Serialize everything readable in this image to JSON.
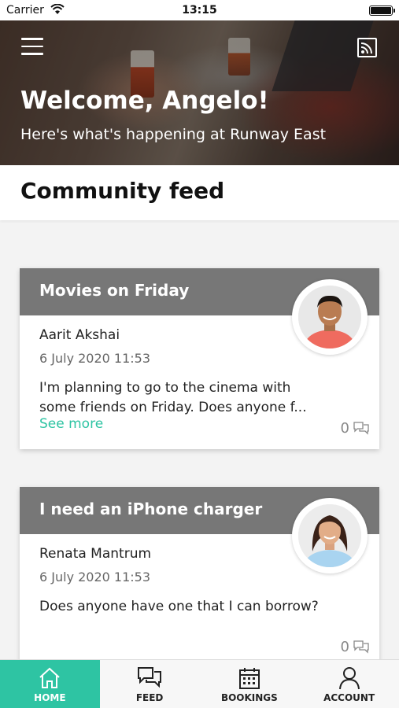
{
  "status_bar": {
    "carrier": "Carrier",
    "time": "13:15"
  },
  "header": {
    "title": "Welcome, Angelo!",
    "subtitle": "Here's what's happening at Runway East"
  },
  "section_title": "Community feed",
  "posts": [
    {
      "title": "Movies on Friday",
      "author": "Aarit Akshai",
      "date": "6 July 2020 11:53",
      "body": "I'm planning to go to the cinema with some friends on Friday. Does anyone f...",
      "see_more": "See more",
      "comment_count": "0"
    },
    {
      "title": "I need an iPhone charger",
      "author": "Renata Mantrum",
      "date": "6 July 2020 11:53",
      "body": "Does anyone have one that I can borrow?",
      "comment_count": "0"
    }
  ],
  "tabs": [
    {
      "label": "HOME",
      "icon": "home-icon",
      "active": true
    },
    {
      "label": "FEED",
      "icon": "chat-icon",
      "active": false
    },
    {
      "label": "BOOKINGS",
      "icon": "calendar-icon",
      "active": false
    },
    {
      "label": "ACCOUNT",
      "icon": "user-icon",
      "active": false
    }
  ],
  "colors": {
    "accent": "#2ec4a3",
    "card_header": "#777777"
  }
}
